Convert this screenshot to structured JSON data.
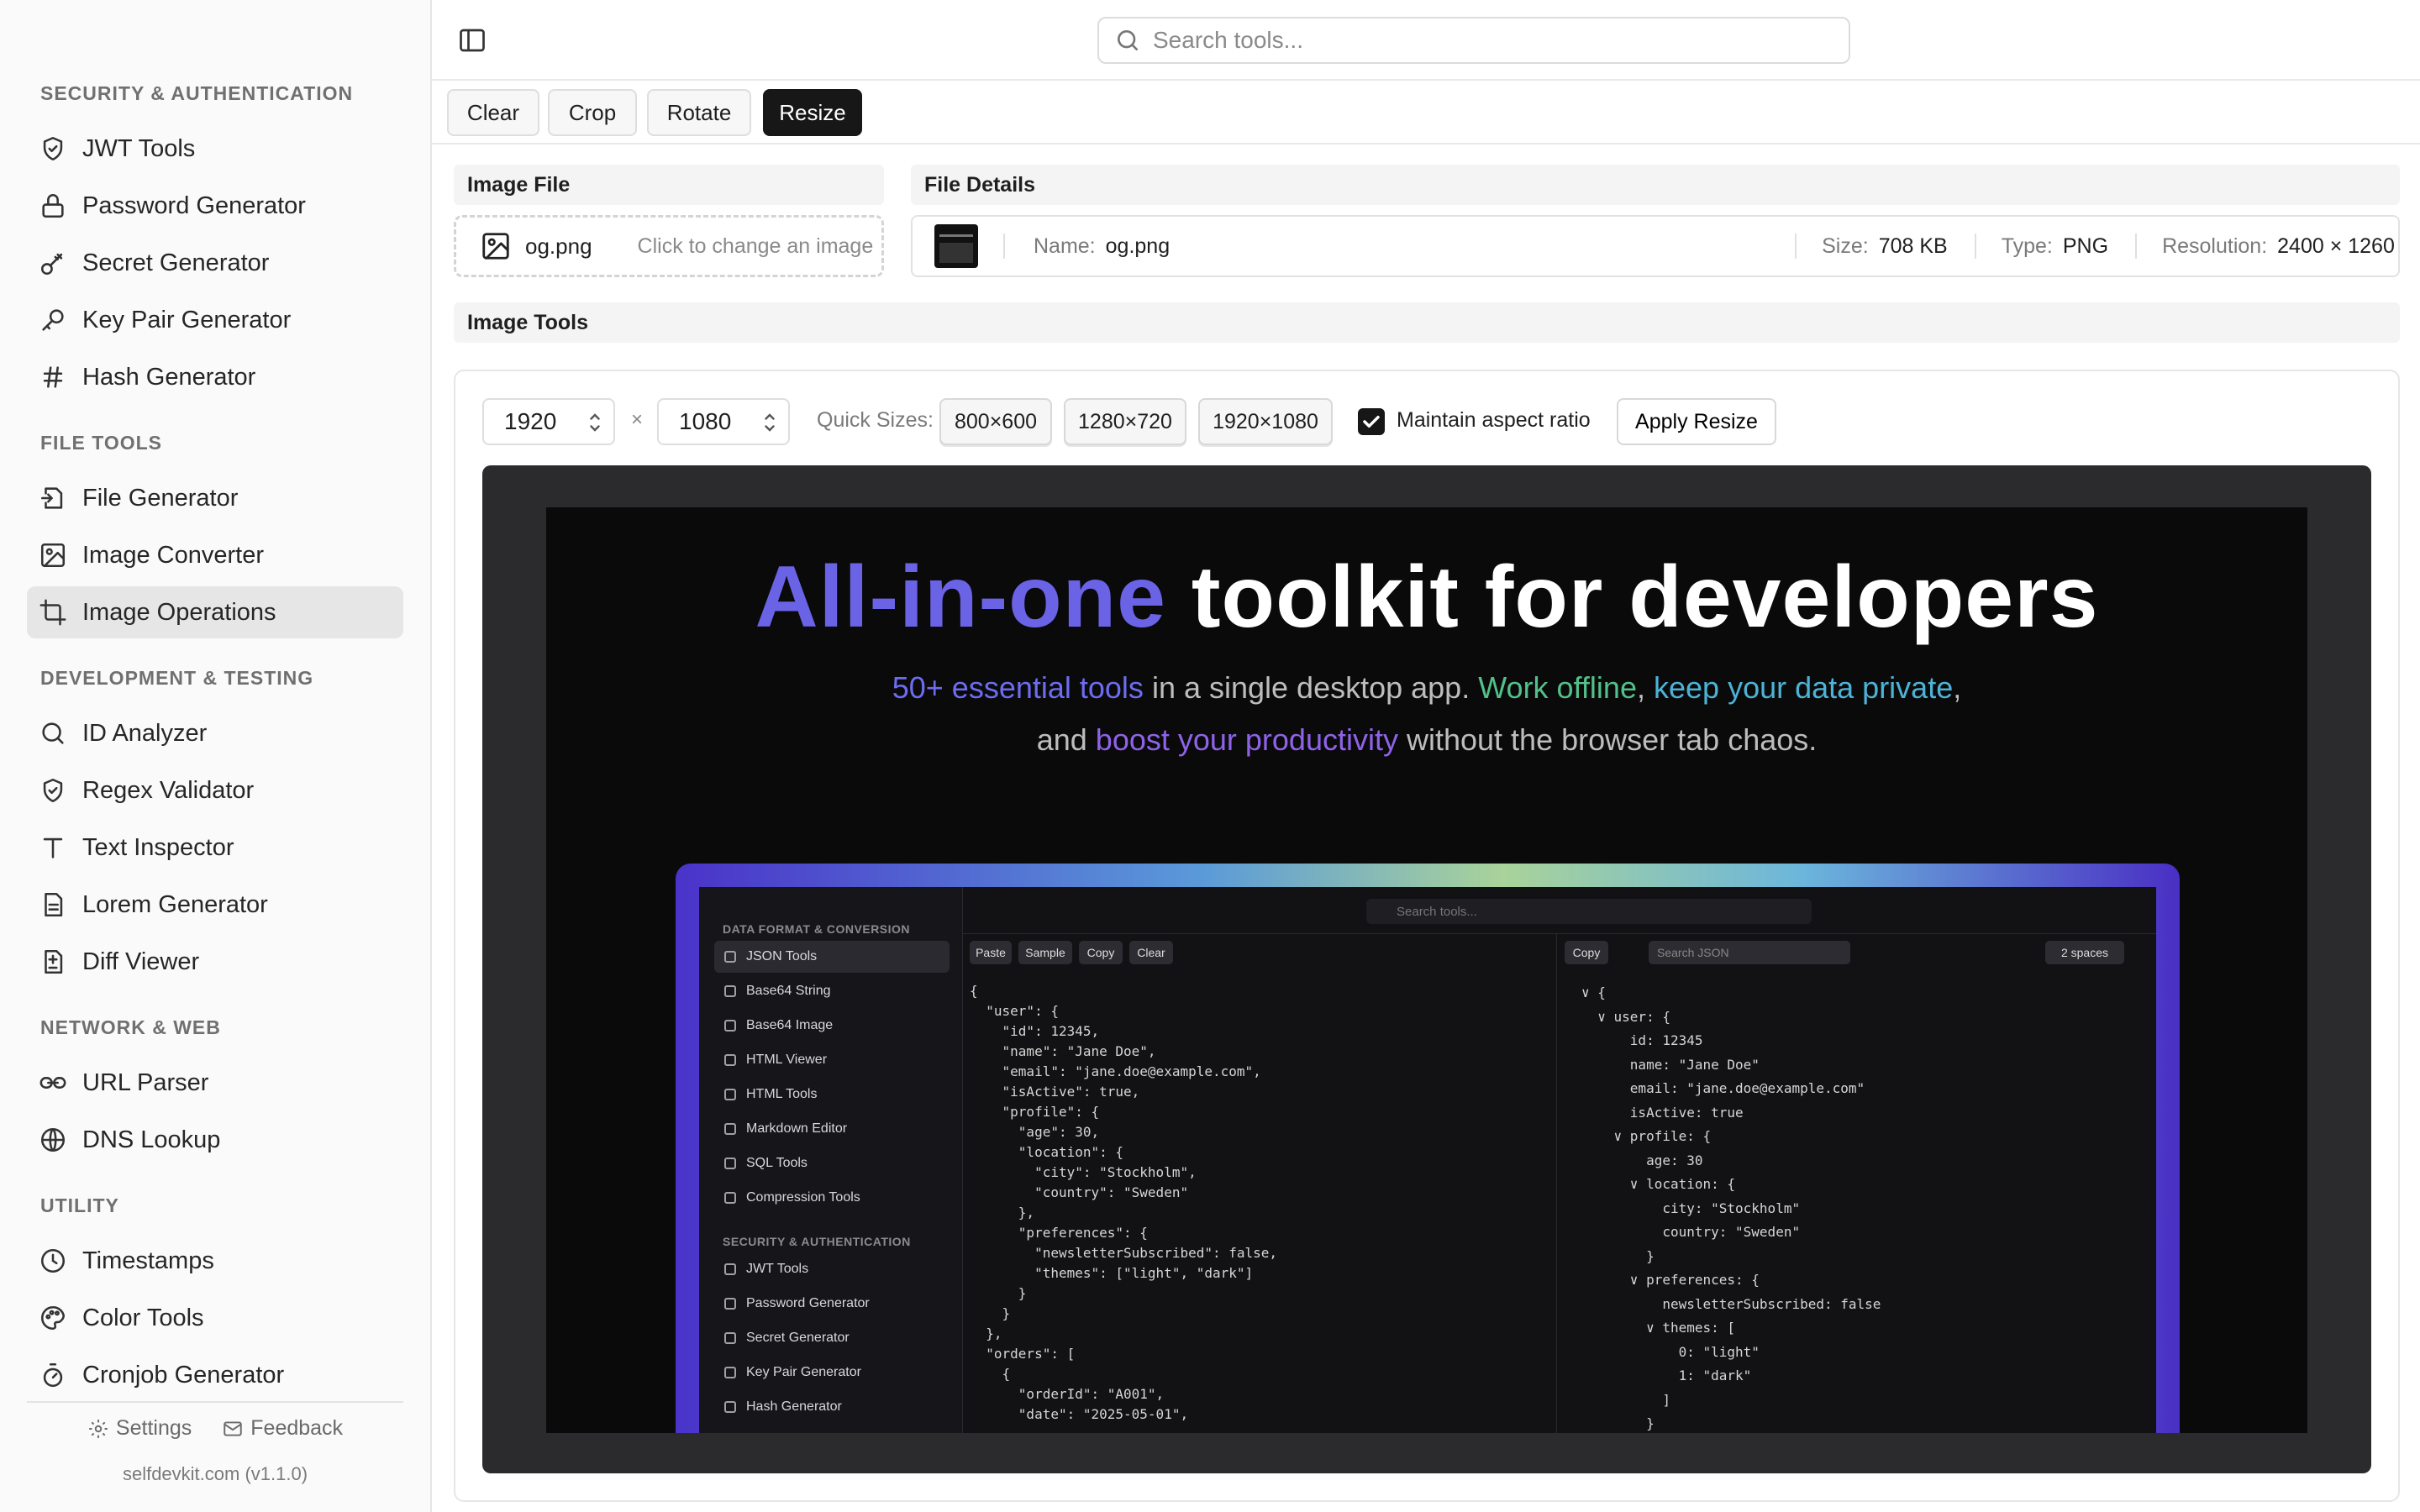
{
  "sidebar": {
    "cut_top_text": "— ˙",
    "sections": [
      {
        "label": "SECURITY & AUTHENTICATION"
      },
      {
        "label": "FILE TOOLS"
      },
      {
        "label": "DEVELOPMENT & TESTING"
      },
      {
        "label": "NETWORK & WEB"
      },
      {
        "label": "UTILITY"
      }
    ],
    "items": [
      {
        "label": "JWT Tools",
        "icon": "shield-check-icon"
      },
      {
        "label": "Password Generator",
        "icon": "lock-icon"
      },
      {
        "label": "Secret Generator",
        "icon": "key-round-icon"
      },
      {
        "label": "Key Pair Generator",
        "icon": "key-icon"
      },
      {
        "label": "Hash Generator",
        "icon": "hash-icon"
      },
      {
        "label": "File Generator",
        "icon": "file-input-icon"
      },
      {
        "label": "Image Converter",
        "icon": "image-icon"
      },
      {
        "label": "Image Operations",
        "icon": "crop-icon",
        "active": true
      },
      {
        "label": "ID Analyzer",
        "icon": "search-icon"
      },
      {
        "label": "Regex Validator",
        "icon": "shield-check-icon"
      },
      {
        "label": "Text Inspector",
        "icon": "type-icon"
      },
      {
        "label": "Lorem Generator",
        "icon": "file-text-icon"
      },
      {
        "label": "Diff Viewer",
        "icon": "file-diff-icon"
      },
      {
        "label": "URL Parser",
        "icon": "link-icon"
      },
      {
        "label": "DNS Lookup",
        "icon": "globe-icon"
      },
      {
        "label": "Timestamps",
        "icon": "clock-icon"
      },
      {
        "label": "Color Tools",
        "icon": "palette-icon"
      },
      {
        "label": "Cronjob Generator",
        "icon": "timer-icon"
      }
    ],
    "footer": {
      "settings": "Settings",
      "feedback": "Feedback",
      "version": "selfdevkit.com (v1.1.0)"
    }
  },
  "header": {
    "search_placeholder": "Search tools..."
  },
  "toolbar": {
    "clear": "Clear",
    "crop": "Crop",
    "rotate": "Rotate",
    "resize": "Resize",
    "active": "Resize"
  },
  "image_file": {
    "title": "Image File",
    "filename": "og.png",
    "hint": "Click to change an image"
  },
  "file_details": {
    "title": "File Details",
    "name_label": "Name:",
    "name": "og.png",
    "size_label": "Size:",
    "size": "708 KB",
    "type_label": "Type:",
    "type": "PNG",
    "resolution_label": "Resolution:",
    "resolution": "2400 × 1260"
  },
  "image_tools": {
    "title": "Image Tools",
    "width": "1920",
    "height": "1080",
    "times": "×",
    "quick_sizes_label": "Quick Sizes:",
    "quick_sizes": [
      "800×600",
      "1280×720",
      "1920×1080"
    ],
    "maintain_aspect_label": "Maintain aspect ratio",
    "maintain_aspect": true,
    "apply": "Apply Resize"
  },
  "preview": {
    "title_accent": "All-in-one",
    "title_rest": " toolkit for developers",
    "line1": {
      "a": "50+ essential tools",
      "b": " in a single desktop app. ",
      "c": "Work offline",
      "d": ", ",
      "e": "keep your data private",
      "f": ","
    },
    "line2": {
      "a": "and ",
      "b": "boost your productivity",
      "c": " without the browser tab chaos."
    },
    "inner": {
      "sec1": "DATA FORMAT & CONVERSION",
      "items1": [
        "JSON Tools",
        "Base64 String",
        "Base64 Image",
        "HTML Viewer",
        "HTML Tools",
        "Markdown Editor",
        "SQL Tools",
        "Compression Tools"
      ],
      "sec2": "SECURITY & AUTHENTICATION",
      "items2": [
        "JWT Tools",
        "Password Generator",
        "Secret Generator",
        "Key Pair Generator",
        "Hash Generator"
      ],
      "search": "Search tools...",
      "btns": [
        "Paste",
        "Sample",
        "Copy",
        "Clear"
      ],
      "right_copy": "Copy",
      "right_search": "Search JSON",
      "right_spaces": "2 spaces",
      "code": "{\n  \"user\": {\n    \"id\": 12345,\n    \"name\": \"Jane Doe\",\n    \"email\": \"jane.doe@example.com\",\n    \"isActive\": true,\n    \"profile\": {\n      \"age\": 30,\n      \"location\": {\n        \"city\": \"Stockholm\",\n        \"country\": \"Sweden\"\n      },\n      \"preferences\": {\n        \"newsletterSubscribed\": false,\n        \"themes\": [\"light\", \"dark\"]\n      }\n    }\n  },\n  \"orders\": [\n    {\n      \"orderId\": \"A001\",\n      \"date\": \"2025-05-01\",",
      "tree": "∨ {\n  ∨ user: {\n      id: 12345\n      name: \"Jane Doe\"\n      email: \"jane.doe@example.com\"\n      isActive: true\n    ∨ profile: {\n        age: 30\n      ∨ location: {\n          city: \"Stockholm\"\n          country: \"Sweden\"\n        }\n      ∨ preferences: {\n          newsletterSubscribed: false\n        ∨ themes: [\n            0: \"light\"\n            1: \"dark\"\n          ]\n        }\n      }"
    }
  },
  "colors": {
    "accent_dark": "#171717",
    "title_accent": "#6b63e6",
    "green": "#53c08a",
    "cyan": "#4db3d6",
    "purple": "#8f63e8"
  }
}
